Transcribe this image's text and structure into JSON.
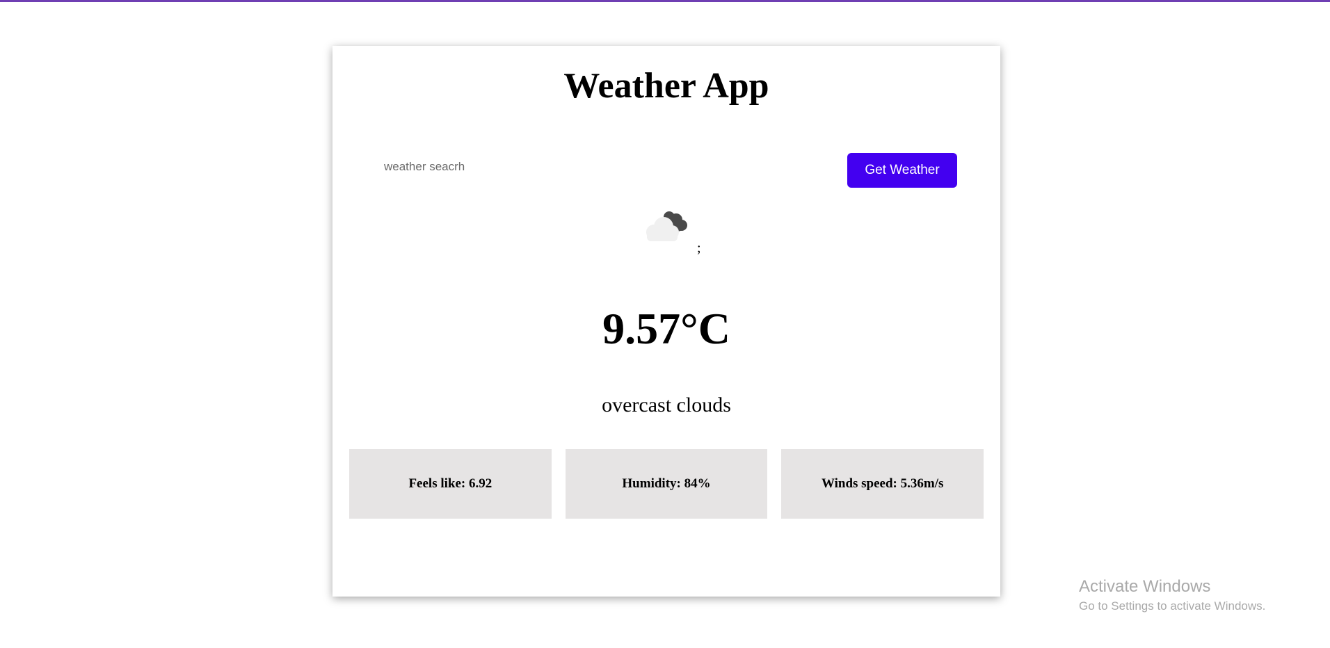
{
  "app": {
    "title": "Weather App"
  },
  "search": {
    "placeholder": "weather seacrh",
    "value": "",
    "button_label": "Get Weather"
  },
  "weather": {
    "icon": "overcast-clouds-icon",
    "icon_caption": ";",
    "temperature": "9.57°C",
    "description": "overcast clouds"
  },
  "stats": [
    {
      "label": "Feels like: 6.92"
    },
    {
      "label": "Humidity: 84%"
    },
    {
      "label": "Winds speed: 5.36m/s"
    }
  ],
  "os_watermark": {
    "title": "Activate Windows",
    "subtitle": "Go to Settings to activate Windows."
  },
  "colors": {
    "accent": "#4300f0",
    "top_bar": "#6f3fb3",
    "stat_background": "#e6e4e4"
  }
}
